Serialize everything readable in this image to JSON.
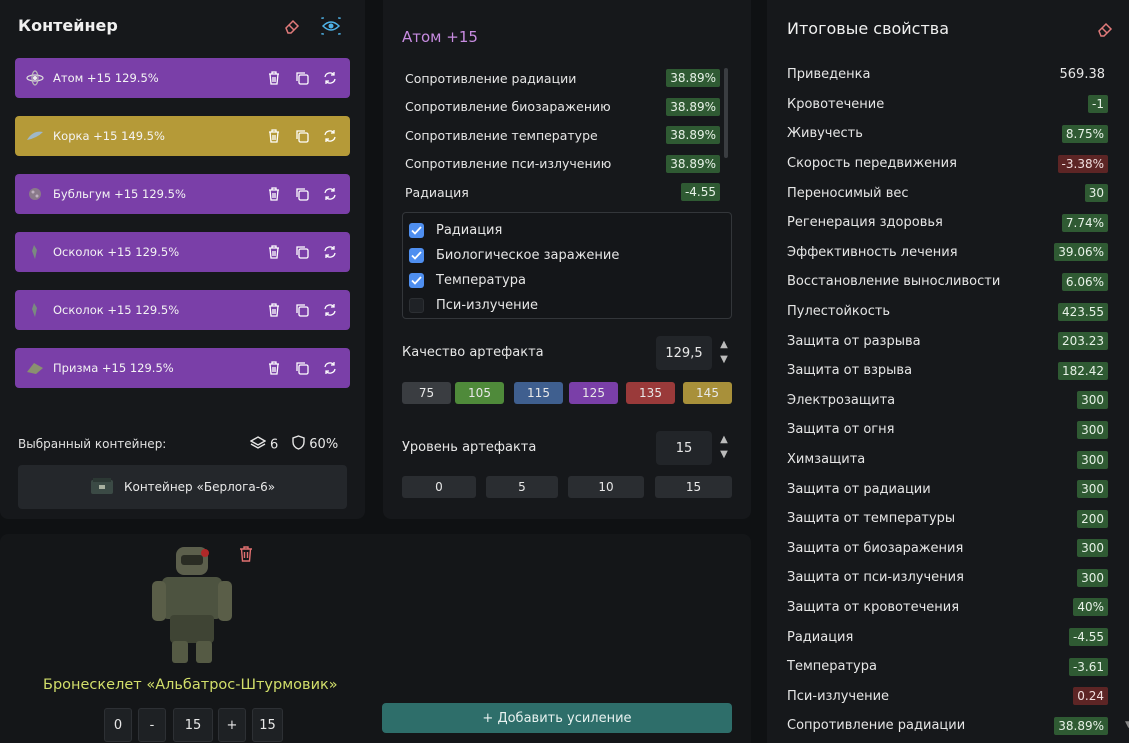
{
  "container": {
    "title": "Контейнер",
    "icons": [
      "eraser-icon",
      "eye-icon"
    ],
    "artifacts": [
      {
        "name": "Атом +15 129.5%",
        "color": "#7a3fa8",
        "icon": "atom-icon"
      },
      {
        "name": "Корка +15 149.5%",
        "color": "#b59a38",
        "icon": "crust-icon"
      },
      {
        "name": "Бубльгум +15 129.5%",
        "color": "#7a3fa8",
        "icon": "bubblegum-icon"
      },
      {
        "name": "Осколок +15 129.5%",
        "color": "#7a3fa8",
        "icon": "shard-icon"
      },
      {
        "name": "Осколок +15 129.5%",
        "color": "#7a3fa8",
        "icon": "shard-icon"
      },
      {
        "name": "Призма +15 129.5%",
        "color": "#7a3fa8",
        "icon": "prism-icon"
      }
    ],
    "selected_label": "Выбранный контейнер:",
    "slots": "6",
    "protection": "60%",
    "container_name": "Контейнер «Берлога-6»"
  },
  "artifact": {
    "title": "Атом +15",
    "properties": [
      {
        "name": "Сопротивление радиации",
        "value": "38.89%",
        "tone": "green"
      },
      {
        "name": "Сопротивление биозаражению",
        "value": "38.89%",
        "tone": "green"
      },
      {
        "name": "Сопротивление температуре",
        "value": "38.89%",
        "tone": "green"
      },
      {
        "name": "Сопротивление пси-излучению",
        "value": "38.89%",
        "tone": "green"
      },
      {
        "name": "Радиация",
        "value": "-4.55",
        "tone": "green"
      }
    ],
    "checks": [
      {
        "label": "Радиация",
        "checked": true
      },
      {
        "label": "Биологическое заражение",
        "checked": true
      },
      {
        "label": "Температура",
        "checked": true
      },
      {
        "label": "Пси-излучение",
        "checked": false
      }
    ],
    "quality_label": "Качество артефакта",
    "quality_value": "129,5",
    "quality_presets": [
      {
        "label": "75",
        "color": "#3a3d41"
      },
      {
        "label": "105",
        "color": "#4f8a3a"
      },
      {
        "label": "115",
        "color": "#3f5f8f"
      },
      {
        "label": "125",
        "color": "#7a3fa8"
      },
      {
        "label": "135",
        "color": "#9a3a3a"
      },
      {
        "label": "145",
        "color": "#a8903a"
      }
    ],
    "level_label": "Уровень артефакта",
    "level_value": "15",
    "level_presets": [
      "0",
      "5",
      "10",
      "15"
    ]
  },
  "stats": {
    "title": "Итоговые свойства",
    "items": [
      {
        "name": "Приведенка",
        "value": "569.38",
        "tone": "plain"
      },
      {
        "name": "Кровотечение",
        "value": "-1",
        "tone": "green"
      },
      {
        "name": "Живучесть",
        "value": "8.75%",
        "tone": "green"
      },
      {
        "name": "Скорость передвижения",
        "value": "-3.38%",
        "tone": "red"
      },
      {
        "name": "Переносимый вес",
        "value": "30",
        "tone": "green"
      },
      {
        "name": "Регенерация здоровья",
        "value": "7.74%",
        "tone": "green"
      },
      {
        "name": "Эффективность лечения",
        "value": "39.06%",
        "tone": "green"
      },
      {
        "name": "Восстановление выносливости",
        "value": "6.06%",
        "tone": "green"
      },
      {
        "name": "Пулестойкость",
        "value": "423.55",
        "tone": "green"
      },
      {
        "name": "Защита от разрыва",
        "value": "203.23",
        "tone": "green"
      },
      {
        "name": "Защита от взрыва",
        "value": "182.42",
        "tone": "green"
      },
      {
        "name": "Электрозащита",
        "value": "300",
        "tone": "green"
      },
      {
        "name": "Защита от огня",
        "value": "300",
        "tone": "green"
      },
      {
        "name": "Химзащита",
        "value": "300",
        "tone": "green"
      },
      {
        "name": "Защита от радиации",
        "value": "300",
        "tone": "green"
      },
      {
        "name": "Защита от температуры",
        "value": "200",
        "tone": "green"
      },
      {
        "name": "Защита от биозаражения",
        "value": "300",
        "tone": "green"
      },
      {
        "name": "Защита от пси-излучения",
        "value": "300",
        "tone": "green"
      },
      {
        "name": "Защита от кровотечения",
        "value": "40%",
        "tone": "green"
      },
      {
        "name": "Радиация",
        "value": "-4.55",
        "tone": "green"
      },
      {
        "name": "Температура",
        "value": "-3.61",
        "tone": "green"
      },
      {
        "name": "Пси-излучение",
        "value": "0.24",
        "tone": "red"
      },
      {
        "name": "Сопротивление радиации",
        "value": "38.89%",
        "tone": "green"
      }
    ]
  },
  "armor": {
    "name": "Бронескелет «Альбатрос-Штурмовик»",
    "level_min": "0",
    "minus": "-",
    "level": "15",
    "plus": "+",
    "level_max": "15",
    "add_button": "+ Добавить усиление"
  }
}
